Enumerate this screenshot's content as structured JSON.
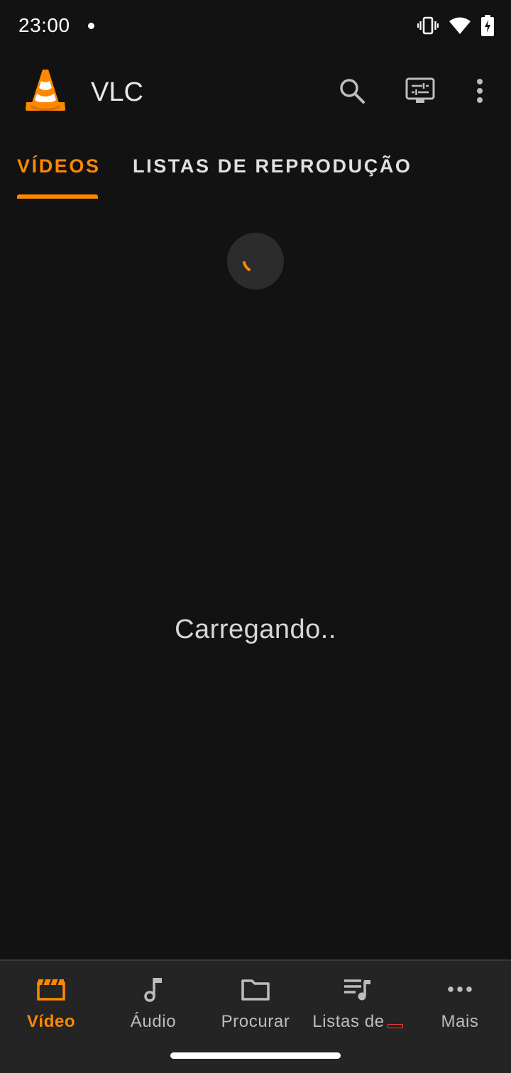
{
  "status_bar": {
    "time": "23:00",
    "icons": [
      "notification-dot",
      "vibrate-icon",
      "wifi-icon",
      "battery-charging-icon"
    ]
  },
  "app_bar": {
    "title": "VLC",
    "logo": "vlc-cone-logo",
    "actions": [
      "search-icon",
      "renderer-cast-icon",
      "more-vert-icon"
    ]
  },
  "tabs": [
    {
      "label": "VÍDEOS",
      "selected": true
    },
    {
      "label": "LISTAS DE REPRODUÇÃO",
      "selected": false
    }
  ],
  "content": {
    "loading_text": "Carregando.."
  },
  "bottom_nav": {
    "items": [
      {
        "label": "Vídeo",
        "icon": "movie-clapper-icon",
        "active": true
      },
      {
        "label": "Áudio",
        "icon": "music-note-icon",
        "active": false
      },
      {
        "label": "Procurar",
        "icon": "folder-icon",
        "active": false
      },
      {
        "label": "Listas de",
        "icon": "playlist-music-icon",
        "active": false
      },
      {
        "label": "Mais",
        "icon": "more-horiz-icon",
        "active": false
      }
    ]
  },
  "colors": {
    "accent": "#ff8800",
    "background": "#121212",
    "nav_background": "#242424"
  }
}
